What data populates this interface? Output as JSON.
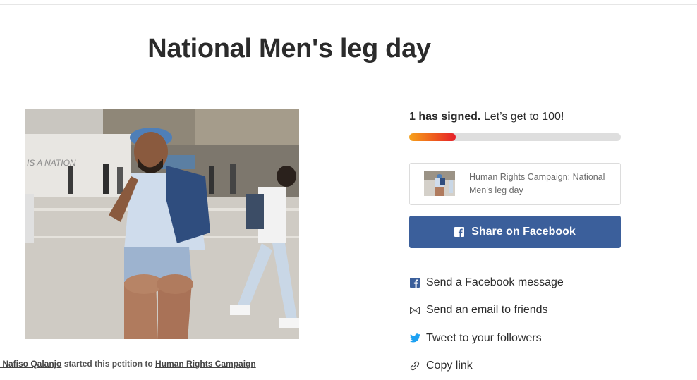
{
  "petition": {
    "title": "National Men's leg day"
  },
  "photo": {
    "sign_text": "IS A NATION",
    "image_alt_icon": "petition-photo"
  },
  "starter": {
    "name": "t Nafiso Qalanjo",
    "middle": " started this petition to ",
    "target": "Human Rights Campaign"
  },
  "progress": {
    "signed_bold": "1 has signed.",
    "signed_rest": " Let’s get to 100!",
    "count": 1,
    "goal": 100,
    "fill_fraction": 0.22,
    "colors": [
      "#f7a21b",
      "#ee5a1e",
      "#e5202b"
    ]
  },
  "preview": {
    "text": "Human Rights Campaign: National Men's leg day"
  },
  "share": {
    "facebook_button": "Share on Facebook",
    "facebook_color": "#3b5f9b",
    "items": [
      {
        "label": "Send a Facebook message",
        "icon": "facebook-icon",
        "color": "#3b5f9b"
      },
      {
        "label": "Send an email to friends",
        "icon": "envelope-icon",
        "color": "#444444"
      },
      {
        "label": "Tweet to your followers",
        "icon": "twitter-icon",
        "color": "#1da1f2"
      },
      {
        "label": "Copy link",
        "icon": "link-icon",
        "color": "#444444"
      }
    ]
  }
}
